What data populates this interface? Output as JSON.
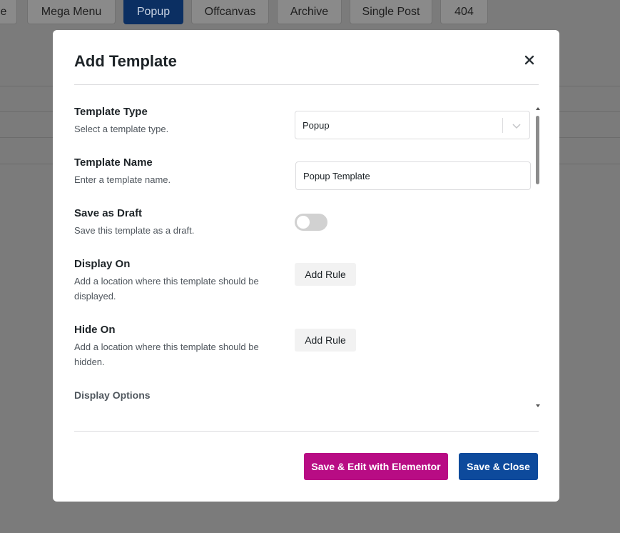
{
  "background_tabs": [
    {
      "label": "e",
      "active": false
    },
    {
      "label": "Mega Menu",
      "active": false
    },
    {
      "label": "Popup",
      "active": true
    },
    {
      "label": "Offcanvas",
      "active": false
    },
    {
      "label": "Archive",
      "active": false
    },
    {
      "label": "Single Post",
      "active": false
    },
    {
      "label": "404",
      "active": false
    }
  ],
  "modal": {
    "title": "Add Template",
    "close_icon": "close-icon",
    "fields": {
      "template_type": {
        "label": "Template Type",
        "description": "Select a template type.",
        "value": "Popup",
        "icon": "chevron-down-icon"
      },
      "template_name": {
        "label": "Template Name",
        "description": "Enter a template name.",
        "value": "Popup Template"
      },
      "save_as_draft": {
        "label": "Save as Draft",
        "description": "Save this template as a draft.",
        "enabled": false
      },
      "display_on": {
        "label": "Display On",
        "description": "Add a location where this template should be displayed.",
        "button_label": "Add Rule"
      },
      "hide_on": {
        "label": "Hide On",
        "description": "Add a location where this template should be hidden.",
        "button_label": "Add Rule"
      }
    },
    "display_options_label": "Display Options",
    "footer": {
      "save_edit_label": "Save & Edit with Elementor",
      "save_close_label": "Save & Close"
    }
  },
  "colors": {
    "overlay": "#7b7b7b",
    "active_tab": "#0b2f62",
    "elementor_button": "#b80c84",
    "primary_button": "#0d4a9c"
  }
}
